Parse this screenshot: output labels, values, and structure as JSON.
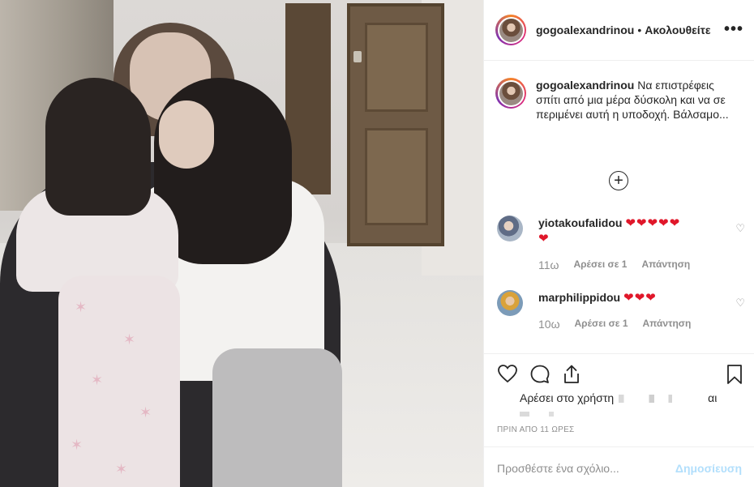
{
  "post": {
    "username": "gogoalexandrinou",
    "separator": "•",
    "follow_status": "Ακολουθείτε",
    "more_icon": "more-horizontal-icon"
  },
  "caption": {
    "username": "gogoalexandrinou",
    "text": "Να επιστρέφεις σπίτι από μια μέρα δύσκολη και να σε περιμένει αυτή η υποδοχή. Βάλσαμο..."
  },
  "load_more_icon": "plus-circle-icon",
  "comments": [
    {
      "username": "yiotakoufalidou",
      "hearts": "❤❤❤❤❤",
      "hearts2": "❤",
      "time": "11ω",
      "likes": "Αρέσει σε 1",
      "reply": "Απάντηση"
    },
    {
      "username": "marphilippidou",
      "hearts": "❤❤❤",
      "time": "10ω",
      "likes": "Αρέσει σε 1",
      "reply": "Απάντηση"
    }
  ],
  "actions": {
    "like_icon": "heart-icon",
    "comment_icon": "comment-icon",
    "share_icon": "share-icon",
    "save_icon": "bookmark-icon"
  },
  "likes_text": "Αρέσει στο χρήστη",
  "likes_tail": "αι",
  "timestamp": "ΠΡΙΝ ΑΠΟ 11 ΩΡΕΣ",
  "add_comment": {
    "placeholder": "Προσθέστε ένα σχόλιο...",
    "post_label": "Δημοσίευση"
  },
  "colors": {
    "heart": "#e0172a",
    "post_button_disabled": "#b2dffc",
    "muted": "#8e8e8e",
    "text": "#262626"
  }
}
